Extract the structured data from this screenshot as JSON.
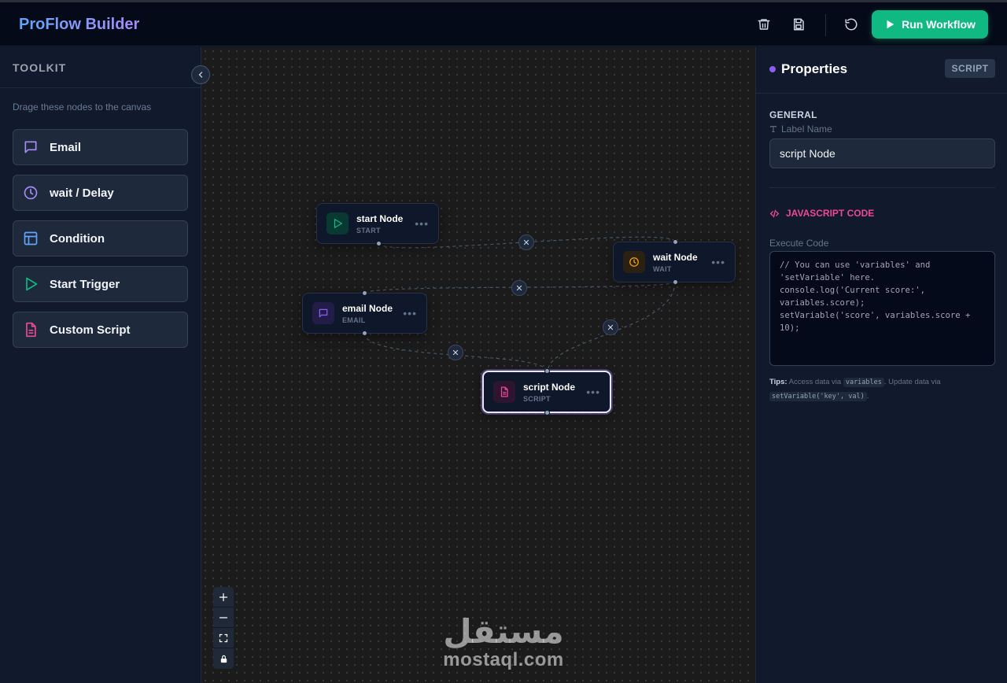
{
  "header": {
    "brand": "ProFlow Builder",
    "run_label": "Run Workflow",
    "colors": {
      "run": "#10b981",
      "brand_from": "#60a5fa",
      "brand_to": "#a78bfa"
    }
  },
  "toolkit": {
    "title": "TOOLKIT",
    "hint": "Drage these nodes to the canvas",
    "items": [
      {
        "label": "Email",
        "icon": "message-square-icon",
        "color": "#a78bfa"
      },
      {
        "label": "wait / Delay",
        "icon": "clock-icon",
        "color": "#a78bfa"
      },
      {
        "label": "Condition",
        "icon": "layout-icon",
        "color": "#60a5fa"
      },
      {
        "label": "Start Trigger",
        "icon": "play-icon",
        "color": "#10b981"
      },
      {
        "label": "Custom Script",
        "icon": "file-text-icon",
        "color": "#ec4899"
      }
    ]
  },
  "canvas": {
    "nodes": [
      {
        "id": "start",
        "label": "start Node",
        "type": "START",
        "icon": "play-icon",
        "color": "#10b981"
      },
      {
        "id": "wait",
        "label": "wait Node",
        "type": "WAIT",
        "icon": "clock-icon",
        "color": "#f59e0b"
      },
      {
        "id": "email",
        "label": "email Node",
        "type": "EMAIL",
        "icon": "message-square-icon",
        "color": "#8b5cf6"
      },
      {
        "id": "script",
        "label": "script Node",
        "type": "SCRIPT",
        "icon": "file-text-icon",
        "color": "#ec4899",
        "selected": true
      }
    ],
    "edges": [
      {
        "from": "start",
        "to": "wait"
      },
      {
        "from": "wait",
        "to": "email"
      },
      {
        "from": "wait",
        "to": "script"
      },
      {
        "from": "email",
        "to": "script"
      }
    ],
    "zoom_controls": [
      "+",
      "−",
      "fit",
      "lock"
    ],
    "watermark": {
      "arabic": "مستقل",
      "latin": "mostaql.com"
    }
  },
  "properties": {
    "title": "Properties",
    "badge": "SCRIPT",
    "general": "GENERAL",
    "label_name": "Label Name",
    "label_value": "script Node",
    "js_section": "JAVASCRIPT CODE",
    "execute_label": "Execute Code",
    "code": "// You can use 'variables' and\n'setVariable' here.\nconsole.log('Current score:',\nvariables.score);\nsetVariable('score', variables.score +\n10);",
    "tips_label": "Tips:",
    "tips_text1": " Access data via ",
    "tips_code1": "variables",
    "tips_text2": ". Update data via ",
    "tips_code2": "setVariable('key', val)",
    "tips_text3": "."
  }
}
